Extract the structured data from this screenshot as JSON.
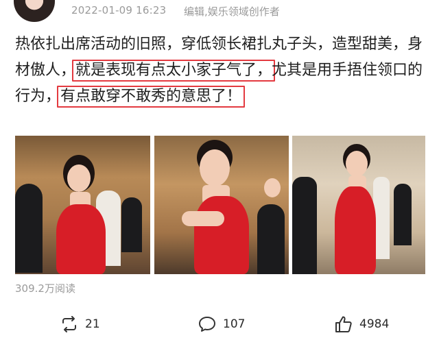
{
  "post": {
    "timestamp": "2022-01-09 16:23",
    "source": "编辑,娱乐领域创作者",
    "text": {
      "part1": "热依扎出席活动的旧照，穿低领长裙扎丸子头，造型甜美，身材傲人，",
      "highlight1": "就是表现有点太小家子气了，",
      "part2": "尤其是用手捂住领口的行为，",
      "highlight2": "有点敢穿不敢秀的意思了！"
    },
    "views": "309.2万阅读"
  },
  "actions": {
    "repost_count": "21",
    "comment_count": "107",
    "like_count": "4984"
  },
  "colors": {
    "highlight_border": "#e3393f",
    "meta_text": "#9a9a9a"
  },
  "icons": [
    "avatar",
    "repost-icon",
    "comment-icon",
    "like-icon"
  ]
}
